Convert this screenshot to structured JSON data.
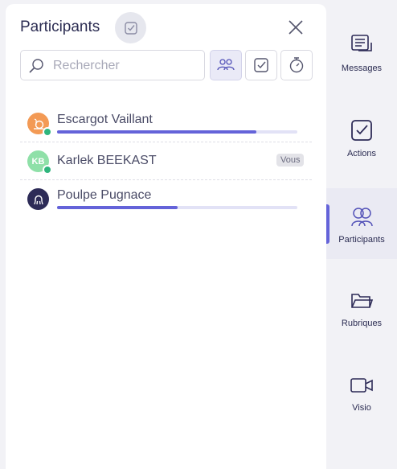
{
  "panel": {
    "title": "Participants",
    "search": {
      "placeholder": "Rechercher",
      "value": ""
    }
  },
  "participants": [
    {
      "name": "Escargot Vaillant",
      "progress": 0.83,
      "avatar": "snail-avatar",
      "avatar_color": "#f39a55",
      "online": true,
      "you": ""
    },
    {
      "name": "Karlek BEEKAST",
      "progress": null,
      "avatar": "initials-avatar",
      "initials": "KB",
      "avatar_color": "#8fe0a8",
      "online": true,
      "you": "Vous"
    },
    {
      "name": "Poulpe Pugnace",
      "progress": 0.5,
      "avatar": "octopus-avatar",
      "avatar_color": "#2d2b57",
      "online": false,
      "you": ""
    }
  ],
  "sidebar": {
    "items": [
      {
        "label": "Messages",
        "icon": "messages-icon",
        "active": false
      },
      {
        "label": "Actions",
        "icon": "actions-icon",
        "active": false
      },
      {
        "label": "Participants",
        "icon": "participants-icon",
        "active": true
      },
      {
        "label": "Rubriques",
        "icon": "folder-icon",
        "active": false
      },
      {
        "label": "Visio",
        "icon": "video-icon",
        "active": false
      }
    ]
  },
  "colors": {
    "accent": "#6463d9",
    "online": "#2fb57d",
    "text": "#2b2c52"
  }
}
